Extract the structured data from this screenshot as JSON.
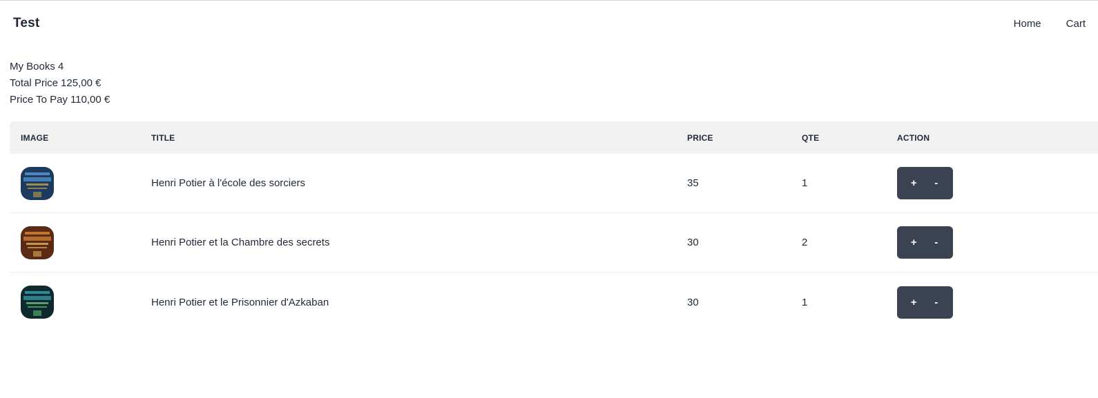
{
  "navbar": {
    "brand": "Test",
    "links": [
      {
        "label": "Home"
      },
      {
        "label": "Cart"
      }
    ]
  },
  "summary": {
    "books_label": "My Books",
    "books_count": "4",
    "total_label": "Total Price",
    "total_value": "125,00 €",
    "pay_label": "Price To Pay",
    "pay_value": "110,00 €"
  },
  "table": {
    "headers": {
      "image": "IMAGE",
      "title": "TITLE",
      "price": "PRICE",
      "qte": "QTE",
      "action": "ACTION"
    },
    "rows": [
      {
        "title": "Henri Potier à l'école des sorciers",
        "price": "35",
        "qte": "1",
        "cover_colors": [
          "#1d3a5f",
          "#5a9bd4",
          "#e0b04a"
        ],
        "plus_label": "+",
        "minus_label": "-"
      },
      {
        "title": "Henri Potier et la Chambre des secrets",
        "price": "30",
        "qte": "2",
        "cover_colors": [
          "#5a2a14",
          "#d98a3a",
          "#f2c46a"
        ],
        "plus_label": "+",
        "minus_label": "-"
      },
      {
        "title": "Henri Potier et le Prisonnier d'Azkaban",
        "price": "30",
        "qte": "1",
        "cover_colors": [
          "#0f2a2e",
          "#3aa0b0",
          "#6fd38a"
        ],
        "plus_label": "+",
        "minus_label": "-"
      }
    ]
  },
  "colors": {
    "button_bg": "#3b4252",
    "header_bg": "#f2f2f2",
    "text": "#1f2937"
  }
}
